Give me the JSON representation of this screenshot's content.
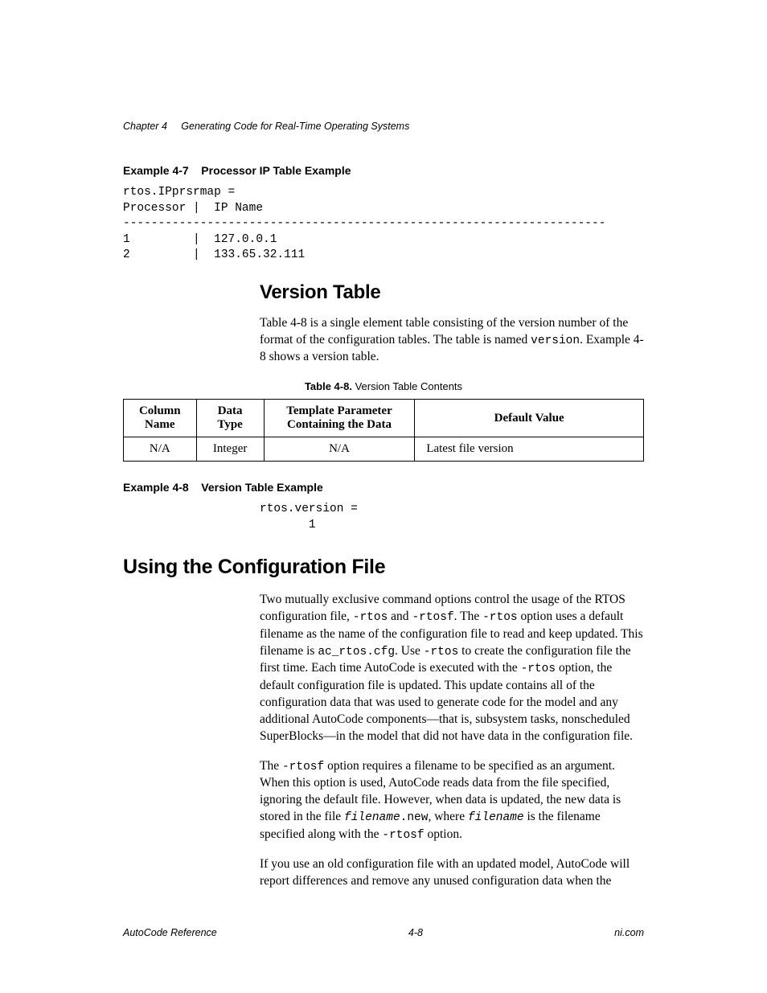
{
  "running_header": {
    "chapter_label": "Chapter 4",
    "chapter_title": "Generating Code for Real-Time Operating Systems"
  },
  "example47": {
    "label": "Example 4-7",
    "title": "Processor IP Table Example",
    "code": "rtos.IPprsrmap =\nProcessor |  IP Name\n---------------------------------------------------------------------\n1         |  127.0.0.1\n2         |  133.65.32.111"
  },
  "version_section": {
    "heading": "Version Table",
    "para_parts": {
      "p1": "Table 4-8 is a single element table consisting of the version number of the format of the configuration tables. The table is named ",
      "p1_code": "version",
      "p1b": ". Example 4-8 shows a version table."
    }
  },
  "table48": {
    "caption_label": "Table 4-8.  ",
    "caption_text": "Version Table Contents",
    "headers": {
      "c1a": "Column",
      "c1b": "Name",
      "c2a": "Data",
      "c2b": "Type",
      "c3a": "Template Parameter",
      "c3b": "Containing the Data",
      "c4": "Default Value"
    },
    "row": {
      "c1": "N/A",
      "c2": "Integer",
      "c3": "N/A",
      "c4": "Latest file version"
    }
  },
  "example48": {
    "label": "Example 4-8",
    "title": "Version Table Example",
    "code": "rtos.version =\n       1"
  },
  "config_section": {
    "heading": "Using the Configuration File",
    "p1": {
      "t1": "Two mutually exclusive command options control the usage of the RTOS configuration file, ",
      "c1": "-rtos",
      "t2": " and ",
      "c2": "-rtosf",
      "t3": ". The ",
      "c3": "-rtos",
      "t4": " option uses a default filename as the name of the configuration file to read and keep updated. This filename is ",
      "c4": "ac_rtos.cfg",
      "t5": ". Use ",
      "c5": "-rtos",
      "t6": " to create the configuration file the first time. Each time AutoCode is executed with the ",
      "c6": "-rtos",
      "t7": " option, the default configuration file is updated. This update contains all of the configuration data that was used to generate code for the model and any additional AutoCode components—that is, subsystem tasks, nonscheduled SuperBlocks—in the model that did not have data in the configuration file."
    },
    "p2": {
      "t1": "The ",
      "c1": "-rtosf",
      "t2": " option requires a filename to be specified as an argument. When this option is used, AutoCode reads data from the file specified, ignoring the default file. However, when data is updated, the new data is stored in the file ",
      "c2": "filename",
      "c3": ".new",
      "t3": ", where ",
      "c4": "filename",
      "t4": " is the filename specified along with the ",
      "c5": "-rtosf",
      "t5": " option."
    },
    "p3": "If you use an old configuration file with an updated model, AutoCode will report differences and remove any unused configuration data when the"
  },
  "footer": {
    "left": "AutoCode Reference",
    "center": "4-8",
    "right": "ni.com"
  },
  "chart_data": {
    "type": "table",
    "title": "Version Table Contents",
    "columns": [
      "Column Name",
      "Data Type",
      "Template Parameter Containing the Data",
      "Default Value"
    ],
    "rows": [
      [
        "N/A",
        "Integer",
        "N/A",
        "Latest file version"
      ]
    ]
  }
}
